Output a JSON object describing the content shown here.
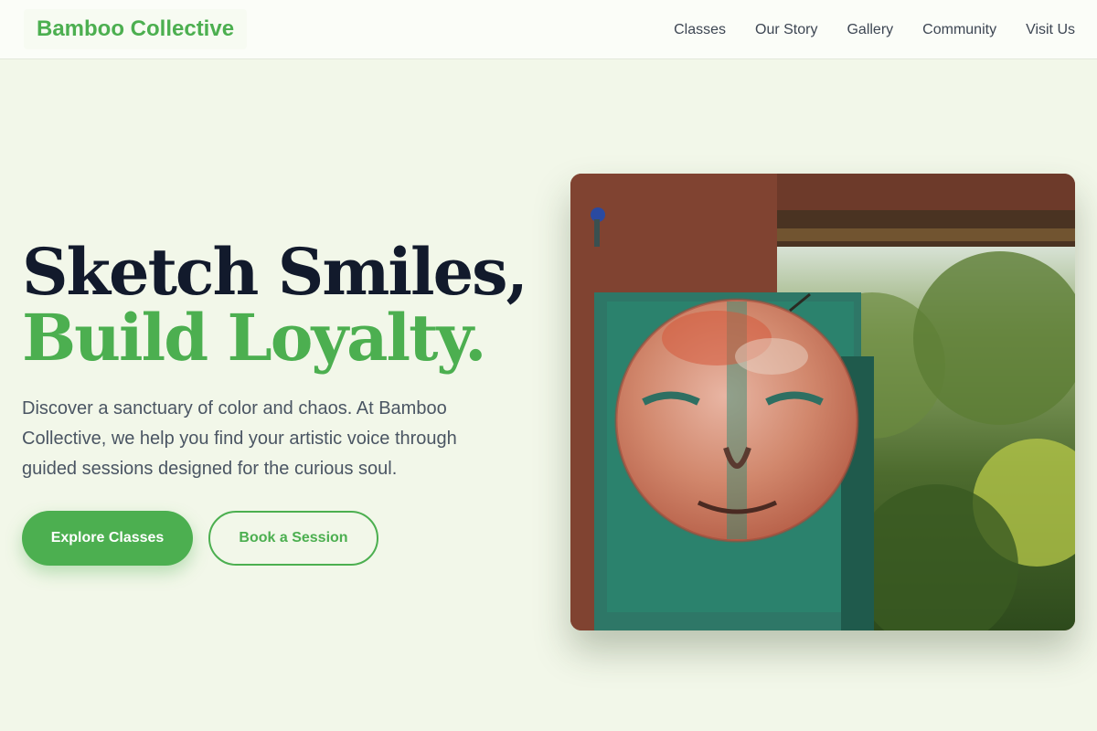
{
  "brand": {
    "name": "Bamboo Collective",
    "accent": "#4caf50"
  },
  "nav": {
    "links": [
      {
        "label": "Classes"
      },
      {
        "label": "Our Story"
      },
      {
        "label": "Gallery"
      },
      {
        "label": "Community"
      },
      {
        "label": "Visit Us"
      }
    ]
  },
  "hero": {
    "headline_line1": "Sketch Smiles,",
    "headline_line2": "Build Loyalty.",
    "description": "Discover a sanctuary of color and chaos. At Bamboo Collective, we help you find your artistic voice through guided sessions designed for the curious soul.",
    "primary_cta": "Explore Classes",
    "secondary_cta": "Book a Session",
    "image_icon": "painted-face-artwork-photo"
  },
  "colors": {
    "background": "#f2f7e9",
    "headline_dark": "#121a2c",
    "text_muted": "#4a5563"
  }
}
